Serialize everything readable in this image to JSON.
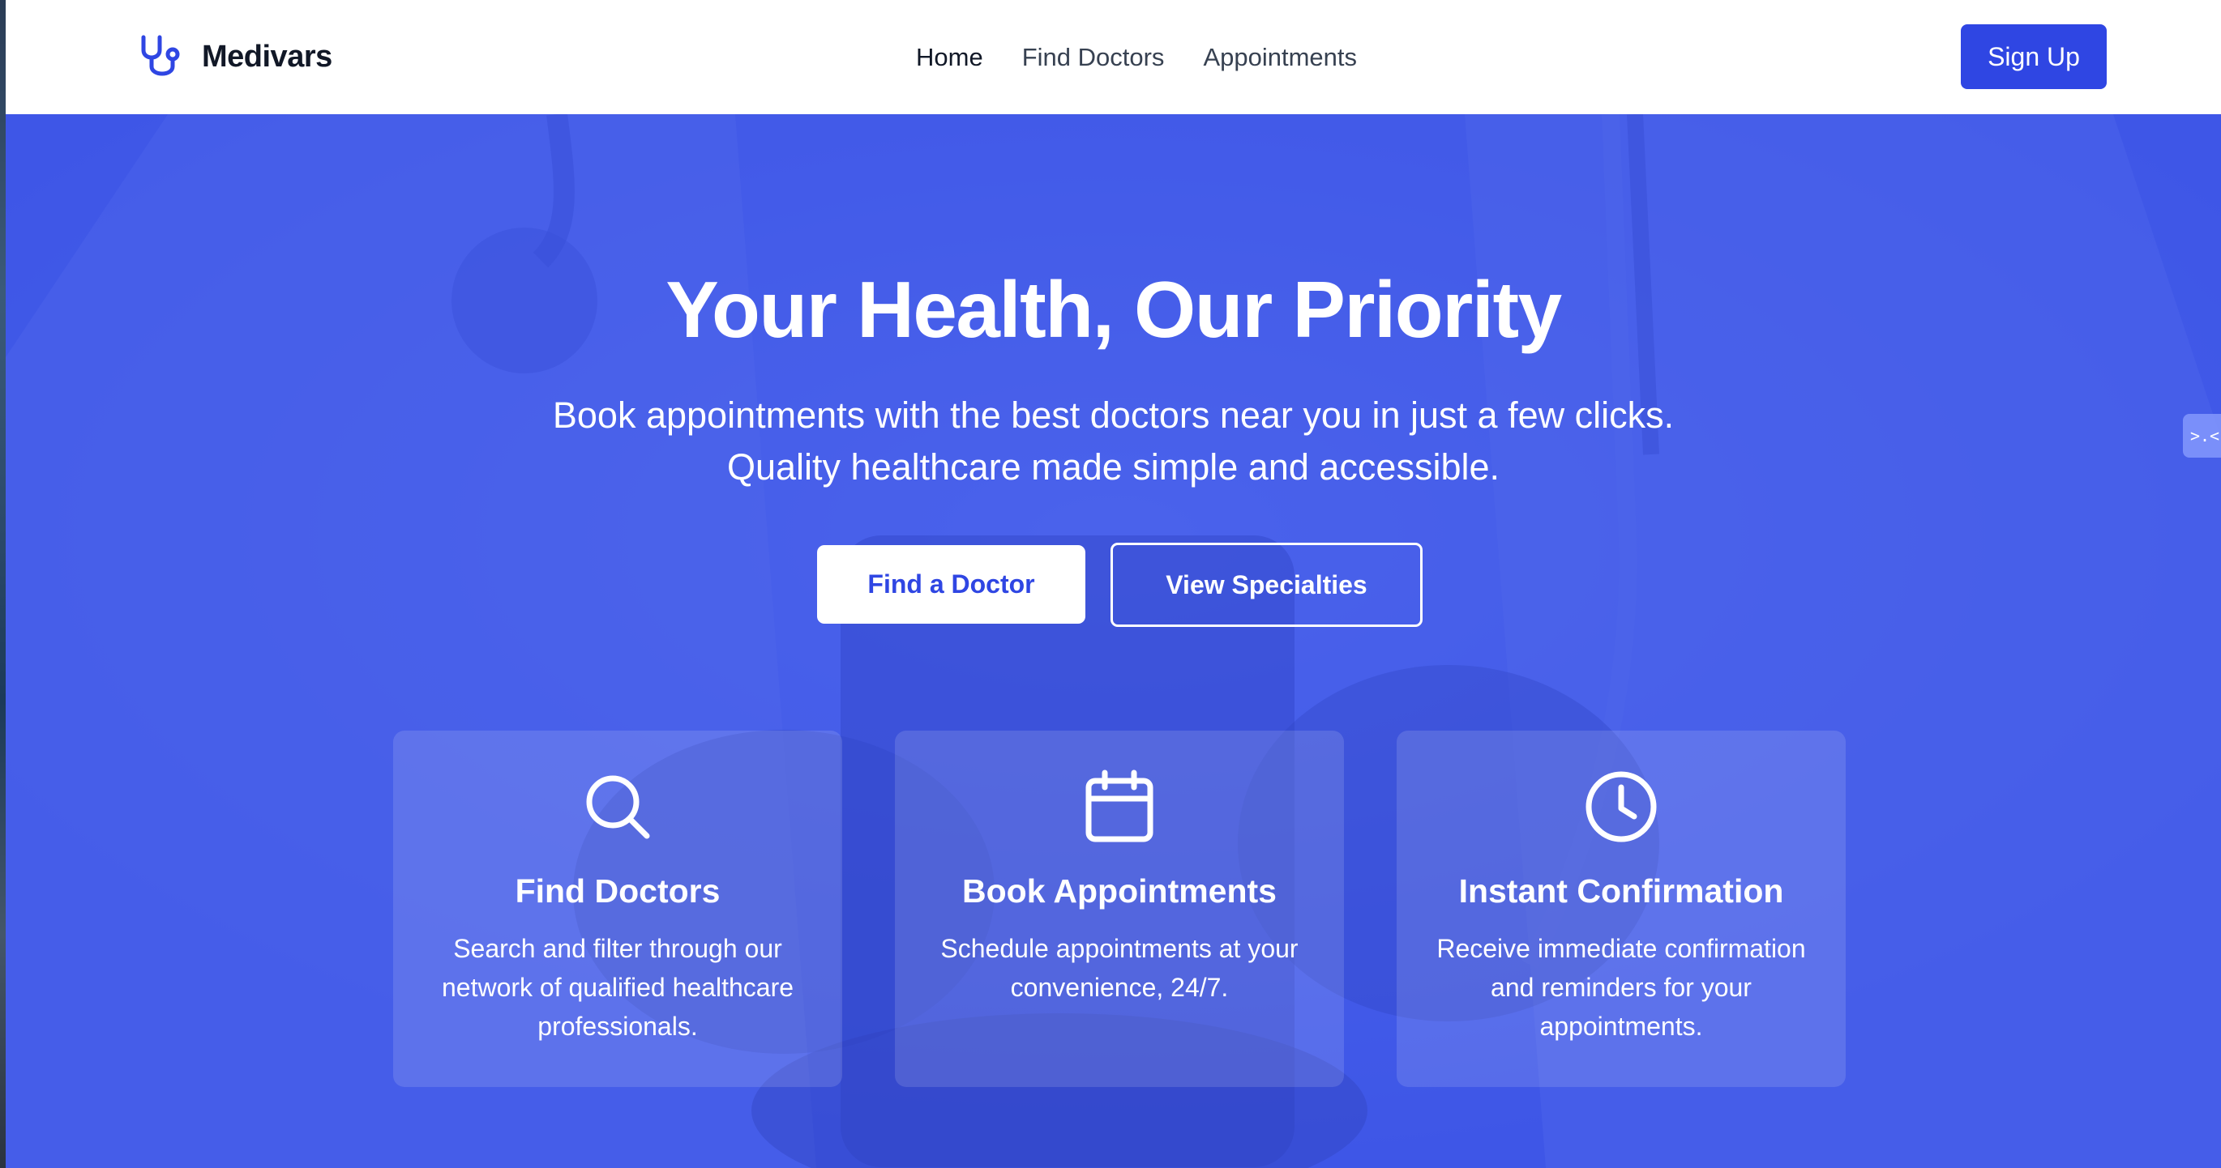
{
  "brand": {
    "name": "Medivars",
    "icon": "stethoscope-icon",
    "accent_color": "#2f46e3"
  },
  "nav": {
    "items": [
      {
        "label": "Home",
        "active": true
      },
      {
        "label": "Find Doctors",
        "active": false
      },
      {
        "label": "Appointments",
        "active": false
      }
    ],
    "signup_label": "Sign Up"
  },
  "hero": {
    "title": "Your Health, Our Priority",
    "subtitle_line1": "Book appointments with the best doctors near you in just a few clicks.",
    "subtitle_line2": "Quality healthcare made simple and accessible.",
    "primary_cta": "Find a Doctor",
    "secondary_cta": "View Specialties",
    "overlay_color": "#3e56e8"
  },
  "features": [
    {
      "icon": "search-icon",
      "title": "Find Doctors",
      "text": "Search and filter through our network of qualified healthcare professionals."
    },
    {
      "icon": "calendar-icon",
      "title": "Book Appointments",
      "text": "Schedule appointments at your convenience, 24/7."
    },
    {
      "icon": "clock-icon",
      "title": "Instant Confirmation",
      "text": "Receive immediate confirmation and reminders for your appointments."
    }
  ],
  "side_widget": {
    "icon": "collapse-arrows-icon",
    "label": ">.<"
  }
}
